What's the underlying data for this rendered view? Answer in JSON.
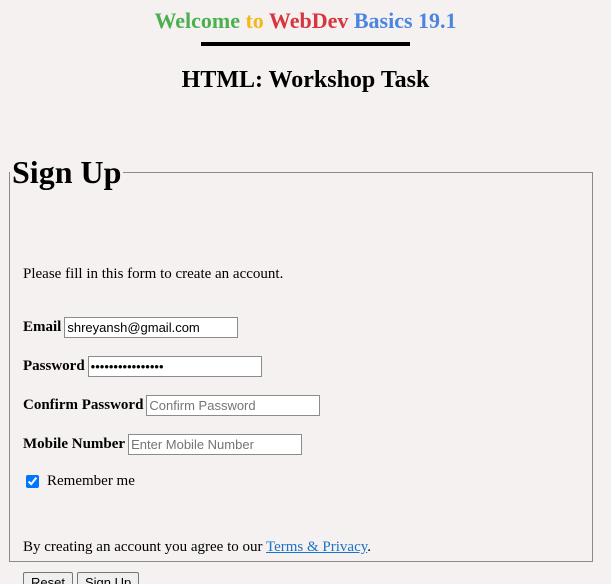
{
  "header": {
    "welcome": {
      "word1": "Welcome",
      "word2": "to",
      "word3": "WebDev",
      "word4": "Basics",
      "version": "19.1"
    },
    "subtitle": "HTML: Workshop Task"
  },
  "colors": {
    "welcome": "#4cb050",
    "to": "#f2b91c",
    "webdev": "#d7363e",
    "basics": "#4a86e0",
    "version": "#4a86e0",
    "link": "#1a73c8"
  },
  "form": {
    "legend": "Sign Up",
    "intro": "Please fill in this form to create an account.",
    "email": {
      "label": "Email",
      "value": "shreyansh@gmail.com",
      "placeholder": ""
    },
    "password": {
      "label": "Password",
      "value": "••••••••••••••••",
      "placeholder": ""
    },
    "confirm_password": {
      "label": "Confirm Password",
      "value": "",
      "placeholder": "Confirm Password"
    },
    "mobile": {
      "label": "Mobile Number",
      "value": "",
      "placeholder": "Enter Mobile Number"
    },
    "remember": {
      "label": "Remember me",
      "checked": true
    },
    "agree_text": "By creating an account you agree to our",
    "agree_link": "Terms & Privacy",
    "agree_end": ".",
    "reset_label": "Reset",
    "submit_label": "Sign Up"
  }
}
